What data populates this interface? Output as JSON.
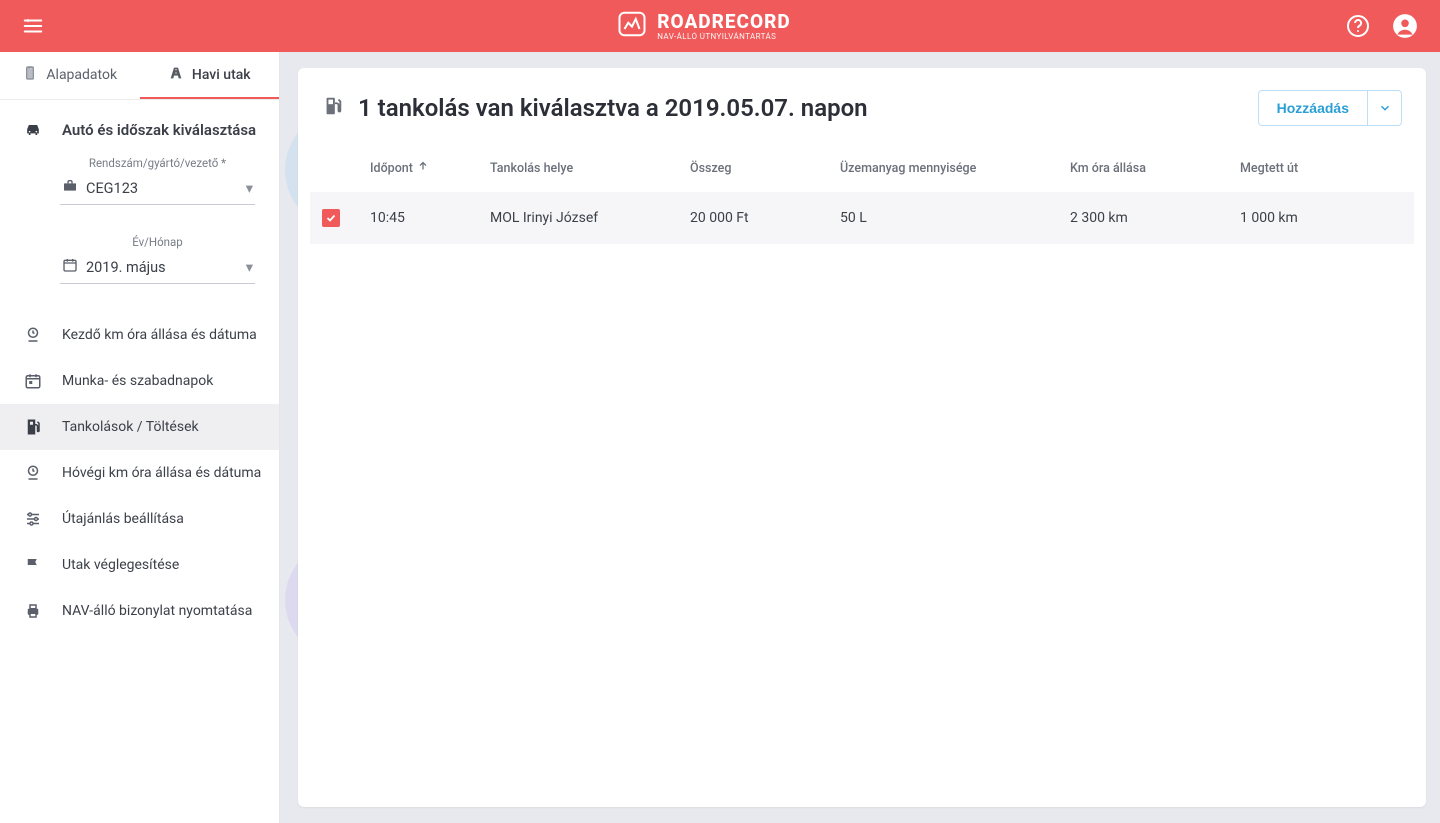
{
  "header": {
    "brand_big": "ROADRECORD",
    "brand_small": "NAV-ÁLLÓ ÚTNYILVÁNTARTÁS"
  },
  "tabs": {
    "t0": "Alapadatok",
    "t1": "Havi utak"
  },
  "sidebar": {
    "section_title": "Autó és időszak kiválasztása",
    "plate_label": "Rendszám/gyártó/vezető *",
    "plate_value": "CEG123",
    "period_label": "Év/Hónap",
    "period_value": "2019. május",
    "items": [
      "Kezdő km óra állása és dátuma",
      "Munka- és szabadnapok",
      "Tankolások / Töltések",
      "Hóvégi km óra állása és dátuma",
      "Útajánlás beállítása",
      "Utak véglegesítése",
      "NAV-álló bizonylat nyomtatása"
    ]
  },
  "main": {
    "title": "1 tankolás van kiválasztva a 2019.05.07. napon",
    "add_button": "Hozzáadás",
    "columns": {
      "c0": "Időpont",
      "c1": "Tankolás helye",
      "c2": "Összeg",
      "c3": "Üzemanyag mennyisége",
      "c4": "Km óra állása",
      "c5": "Megtett út"
    },
    "rows": [
      {
        "time": "10:45",
        "place": "MOL Irinyi József",
        "amount": "20 000 Ft",
        "fuel": "50 L",
        "odo": "2 300 km",
        "dist": "1 000 km"
      }
    ]
  }
}
